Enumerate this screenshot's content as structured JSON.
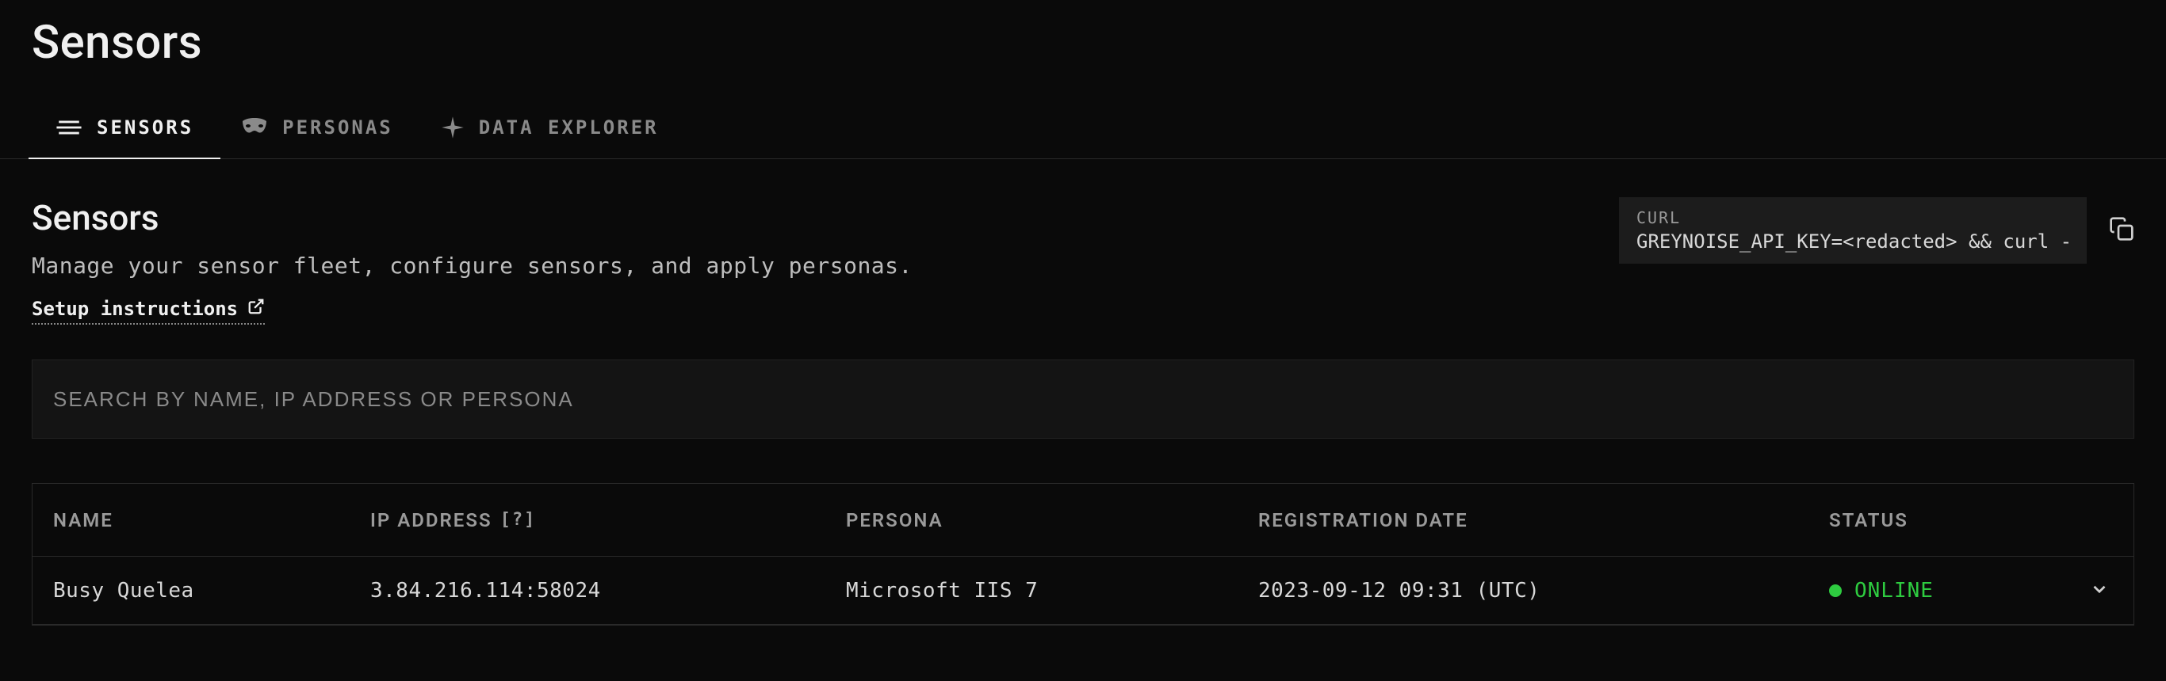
{
  "page_title": "Sensors",
  "tabs": [
    {
      "label": "SENSORS",
      "active": true
    },
    {
      "label": "PERSONAS",
      "active": false
    },
    {
      "label": "DATA EXPLORER",
      "active": false
    }
  ],
  "section": {
    "heading": "Sensors",
    "description": "Manage your sensor fleet, configure sensors, and apply personas.",
    "setup_link_label": "Setup instructions"
  },
  "curl": {
    "label": "CURL",
    "command": "GREYNOISE_API_KEY=<redacted> && curl -"
  },
  "search": {
    "placeholder": "SEARCH BY NAME, IP ADDRESS OR PERSONA",
    "value": ""
  },
  "table": {
    "columns": {
      "name": "NAME",
      "ip": "IP ADDRESS",
      "ip_help": "[?]",
      "persona": "PERSONA",
      "reg_date": "REGISTRATION DATE",
      "status": "STATUS"
    },
    "rows": [
      {
        "name": "Busy Quelea",
        "ip": "3.84.216.114:58024",
        "persona": "Microsoft IIS 7",
        "reg_date": "2023-09-12 09:31 (UTC)",
        "status_label": "ONLINE",
        "status_color": "#2ecc40"
      }
    ]
  }
}
